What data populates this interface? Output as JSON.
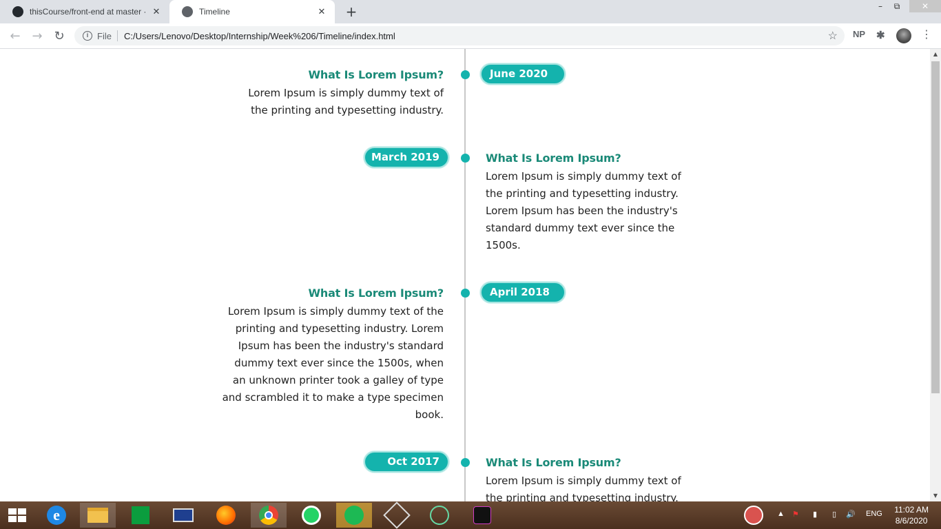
{
  "browser": {
    "tabs": [
      {
        "title": "thisCourse/front-end at master · ",
        "icon": "github-icon"
      },
      {
        "title": "Timeline",
        "icon": "globe-icon"
      }
    ],
    "close_glyph": "✕",
    "new_tab_glyph": "+",
    "url_scheme": "File",
    "url": "C:/Users/Lenovo/Desktop/Internship/Week%206/Timeline/index.html",
    "extension_label": "NP"
  },
  "timeline": {
    "accent": "#14b3ad",
    "heading_color": "#1b8a78",
    "entries": [
      {
        "side": "left",
        "date": "June 2020",
        "title": "What Is Lorem Ipsum?",
        "text": "Lorem Ipsum is simply dummy text of the printing and typesetting industry."
      },
      {
        "side": "right",
        "date": "March 2019",
        "title": "What Is Lorem Ipsum?",
        "text": "Lorem Ipsum is simply dummy text of the printing and typesetting industry. Lorem Ipsum has been the industry's standard dummy text ever since the 1500s."
      },
      {
        "side": "left",
        "date": "April 2018",
        "title": "What Is Lorem Ipsum?",
        "text": "Lorem Ipsum is simply dummy text of the printing and typesetting industry. Lorem Ipsum has been the industry's standard dummy text ever since the 1500s, when an unknown printer took a galley of type and scrambled it to make a type specimen book."
      },
      {
        "side": "right",
        "date": "Oct 2017",
        "title": "What Is Lorem Ipsum?",
        "text": "Lorem Ipsum is simply dummy text of the printing and typesetting industry."
      }
    ]
  },
  "taskbar": {
    "apps": [
      "internet-explorer-icon",
      "file-explorer-icon",
      "store-icon",
      "lenovo-icon",
      "firefox-icon",
      "chrome-icon",
      "whatsapp-icon",
      "spotify-icon",
      "spider-icon",
      "atom-icon",
      "terminal-icon"
    ],
    "language": "ENG",
    "time": "11:02 AM",
    "date": "8/6/2020"
  }
}
